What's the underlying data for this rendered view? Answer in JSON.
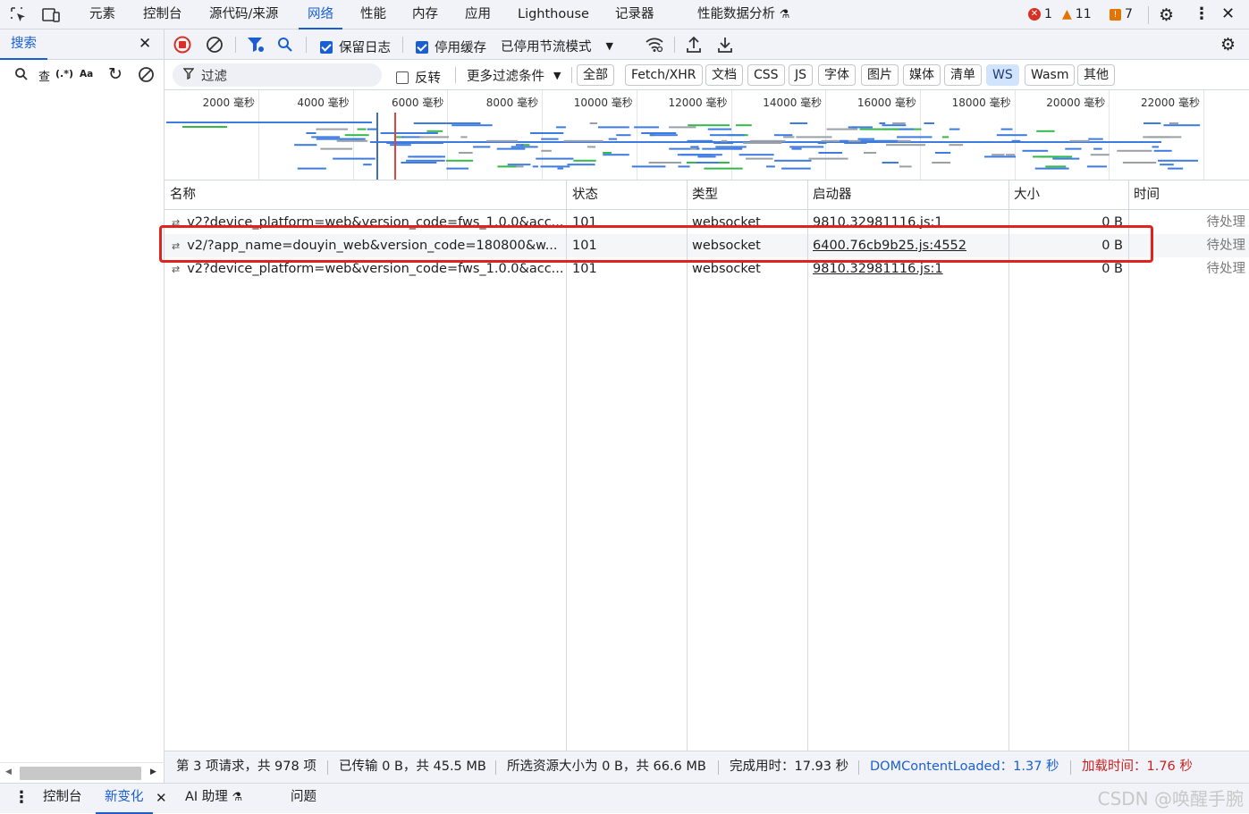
{
  "top_tabs": [
    "元素",
    "控制台",
    "源代码/来源",
    "网络",
    "性能",
    "内存",
    "应用",
    "Lighthouse",
    "记录器",
    "性能数据分析"
  ],
  "active_tab": "网络",
  "badges": {
    "errors": "1",
    "warnings": "11",
    "issues": "7"
  },
  "colors": {
    "accent": "#1a5fd1",
    "error": "#d93025",
    "warning": "#e37400",
    "highlight": "#e0231f"
  },
  "sidebar": {
    "title": "搜索",
    "search_placeholder": "查",
    "regex_label": "(.*)",
    "case_label": "Aa"
  },
  "toolbar": {
    "preserve_log": "保留日志",
    "disable_cache": "停用缓存",
    "throttle": "已停用节流模式",
    "filter_placeholder": "过滤",
    "invert": "反转",
    "more_filters": "更多过滤条件",
    "type_filters": [
      "全部",
      "Fetch/XHR",
      "文档",
      "CSS",
      "JS",
      "字体",
      "图片",
      "媒体",
      "清单",
      "WS",
      "Wasm",
      "其他"
    ],
    "selected_filter": "WS"
  },
  "overview": {
    "ticks": [
      "2000 毫秒",
      "4000 毫秒",
      "6000 毫秒",
      "8000 毫秒",
      "10000 毫秒",
      "12000 毫秒",
      "14000 毫秒",
      "16000 毫秒",
      "18000 毫秒",
      "20000 毫秒",
      "22000 毫秒"
    ]
  },
  "table": {
    "columns": [
      "名称",
      "状态",
      "类型",
      "启动器",
      "大小",
      "时间"
    ],
    "rows": [
      {
        "name": "v2?device_platform=web&version_code=fws_1.0.0&acc...",
        "status": "101",
        "type": "websocket",
        "initiator": "9810.32981116.js:1",
        "size": "0 B",
        "time": "待处理"
      },
      {
        "name": "v2/?app_name=douyin_web&version_code=180800&w...",
        "status": "101",
        "type": "websocket",
        "initiator": "6400.76cb9b25.js:4552",
        "size": "0 B",
        "time": "待处理"
      },
      {
        "name": "v2?device_platform=web&version_code=fws_1.0.0&acc...",
        "status": "101",
        "type": "websocket",
        "initiator": "9810.32981116.js:1",
        "size": "0 B",
        "time": "待处理"
      }
    ]
  },
  "status": {
    "requests": "第 3 项请求，共 978 项",
    "transferred": "已传输 0 B，共 45.5 MB",
    "resources": "所选资源大小为 0 B，共 66.6 MB",
    "finish": "完成用时：17.93 秒",
    "dom_loaded": "DOMContentLoaded：1.37 秒",
    "load": "加载时间：1.76 秒"
  },
  "drawer": {
    "tabs": [
      "控制台",
      "新变化",
      "AI 助理",
      "问题"
    ],
    "active": "新变化"
  },
  "watermark": "CSDN @唤醒手腕"
}
